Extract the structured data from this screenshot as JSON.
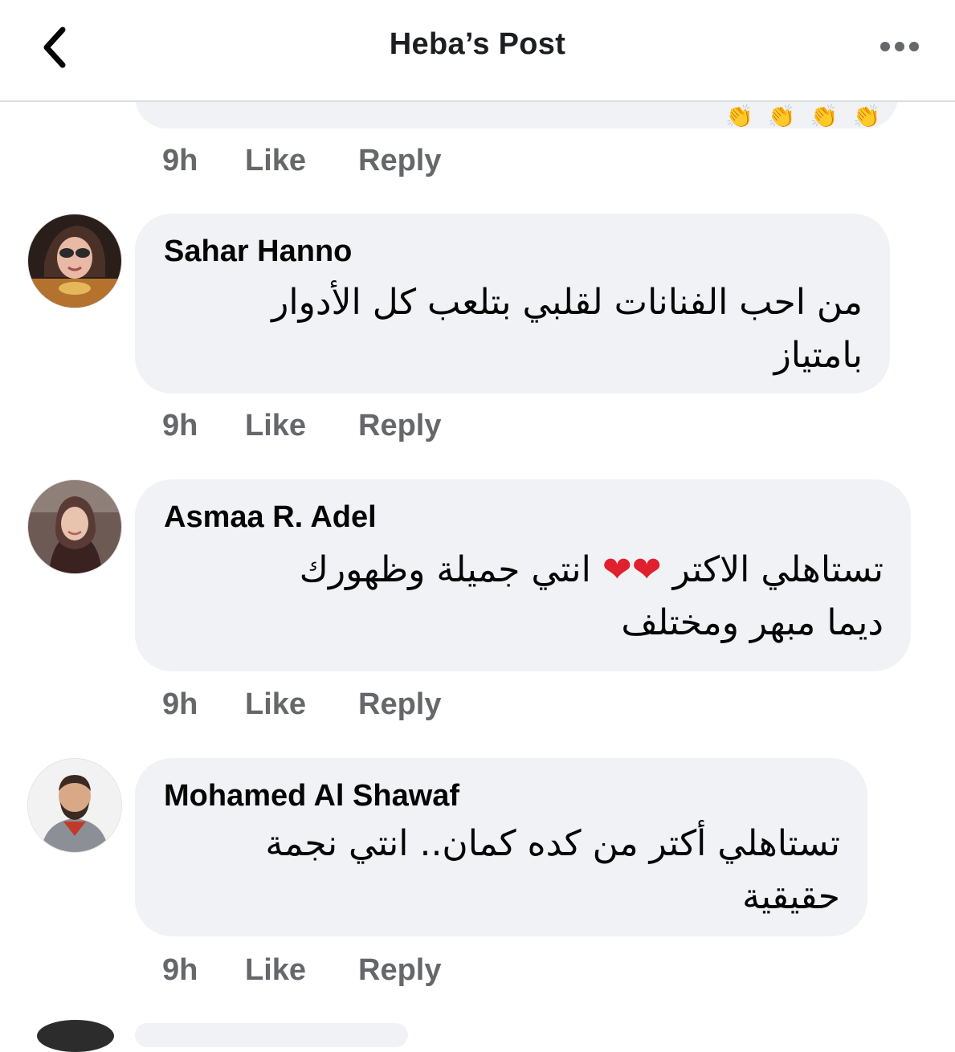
{
  "header": {
    "title": "Heba’s Post",
    "back_icon": "chevron-left-icon",
    "more_icon": "more-horizontal-icon"
  },
  "previous_comment": {
    "emojis": "👏👏👏👏👏👏",
    "time": "9h",
    "like_label": "Like",
    "reply_label": "Reply"
  },
  "comments": [
    {
      "author": "Sahar Hanno",
      "lines": [
        "من احب الفنانات لقلبي بتلعب كل الأدوار",
        "بامتياز"
      ],
      "time": "9h",
      "like_label": "Like",
      "reply_label": "Reply"
    },
    {
      "author": "Asmaa R. Adel",
      "line1_before": "تستاهلي الاكتر ",
      "hearts": "❤❤",
      "line1_after": " انتي جميلة وظهورك",
      "line2": "ديما مبهر ومختلف",
      "time": "9h",
      "like_label": "Like",
      "reply_label": "Reply"
    },
    {
      "author": "Mohamed Al Shawaf",
      "lines": [
        "تستاهلي أكتر من كده كمان.. انتي نجمة",
        "حقيقية"
      ],
      "time": "9h",
      "like_label": "Like",
      "reply_label": "Reply"
    }
  ],
  "colors": {
    "bubble": "#f0f2f5",
    "secondary_text": "#65676b",
    "heart": "#e0202e"
  }
}
